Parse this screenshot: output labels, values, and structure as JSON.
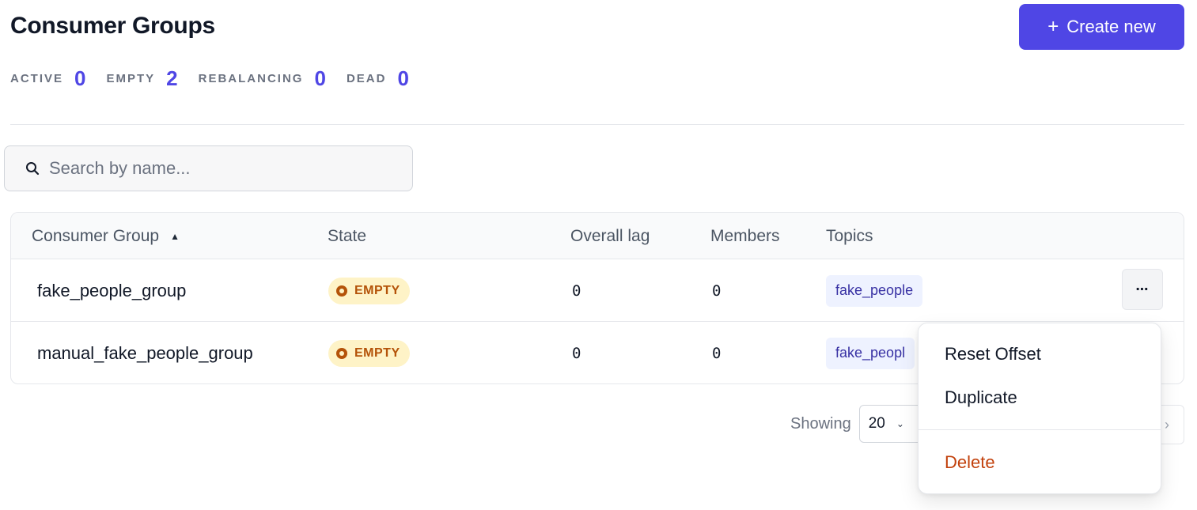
{
  "header": {
    "title": "Consumer Groups",
    "create_button": {
      "icon": "plus-icon",
      "plus": "+",
      "label": "Create new"
    }
  },
  "stats": [
    {
      "label": "ACTIVE",
      "value": "0"
    },
    {
      "label": "EMPTY",
      "value": "2"
    },
    {
      "label": "REBALANCING",
      "value": "0"
    },
    {
      "label": "DEAD",
      "value": "0"
    }
  ],
  "search": {
    "placeholder": "Search by name...",
    "value": "",
    "icon": "search-icon"
  },
  "table": {
    "columns": [
      {
        "label": "Consumer Group",
        "sort": "ascending"
      },
      {
        "label": "State"
      },
      {
        "label": "Overall lag"
      },
      {
        "label": "Members"
      },
      {
        "label": "Topics"
      }
    ],
    "sort_glyph": "▲",
    "rows": [
      {
        "name": "fake_people_group",
        "state": "EMPTY",
        "lag": "0",
        "members": "0",
        "topics": "fake_people"
      },
      {
        "name": "manual_fake_people_group",
        "state": "EMPTY",
        "lag": "0",
        "members": "0",
        "topics": "fake_peopl"
      }
    ],
    "row_menu_glyph": "⋯"
  },
  "row_menu": {
    "items": [
      {
        "label": "Reset Offset"
      },
      {
        "label": "Duplicate"
      },
      {
        "label": "Delete",
        "style": "danger"
      }
    ]
  },
  "pagination": {
    "showing_label": "Showing",
    "page_size": "20",
    "chevron": "⌄",
    "next_glyph": "›"
  },
  "colors": {
    "accent": "#4f46e5",
    "warning": "#b45309",
    "danger": "#c2410c",
    "tag_bg": "#eef2ff"
  }
}
